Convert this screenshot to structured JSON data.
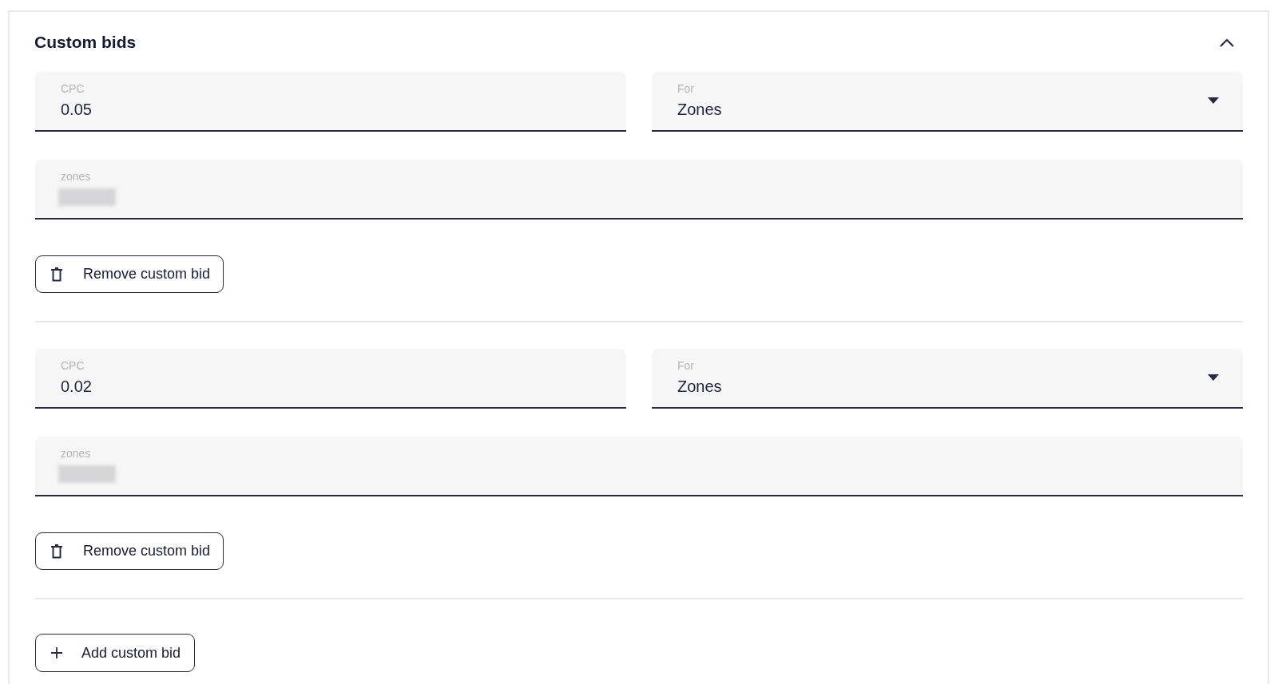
{
  "section": {
    "title": "Custom bids",
    "expanded": true
  },
  "bids": [
    {
      "cpc": {
        "label": "CPC",
        "value": "0.05"
      },
      "for": {
        "label": "For",
        "value": "Zones"
      },
      "zones": {
        "label": "zones",
        "redacted": true
      },
      "remove_button": "Remove custom bid"
    },
    {
      "cpc": {
        "label": "CPC",
        "value": "0.02"
      },
      "for": {
        "label": "For",
        "value": "Zones"
      },
      "zones": {
        "label": "zones",
        "redacted": true
      },
      "remove_button": "Remove custom bid"
    }
  ],
  "add_button": "Add custom bid"
}
